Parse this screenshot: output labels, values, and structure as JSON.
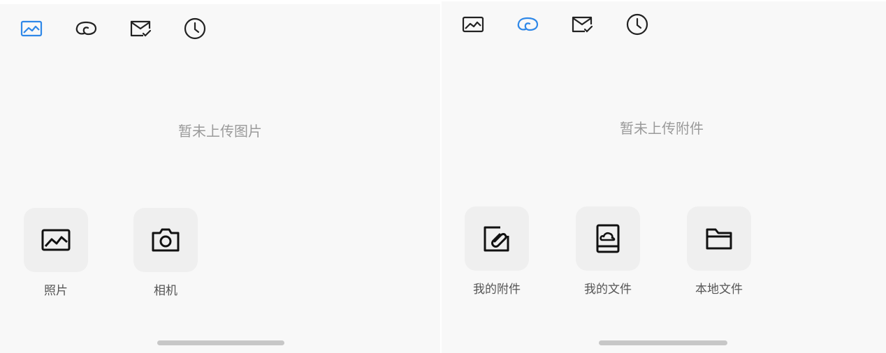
{
  "left_panel": {
    "tabs": [
      {
        "icon": "image-icon",
        "active": true
      },
      {
        "icon": "link-icon",
        "active": false
      },
      {
        "icon": "mail-check-icon",
        "active": false
      },
      {
        "icon": "clock-icon",
        "active": false
      }
    ],
    "empty_text": "暂未上传图片",
    "actions": [
      {
        "icon": "image-icon",
        "label": "照片"
      },
      {
        "icon": "camera-icon",
        "label": "相机"
      }
    ]
  },
  "right_panel": {
    "tabs": [
      {
        "icon": "image-icon",
        "active": false
      },
      {
        "icon": "link-icon",
        "active": true
      },
      {
        "icon": "mail-check-icon",
        "active": false
      },
      {
        "icon": "clock-icon",
        "active": false
      }
    ],
    "empty_text": "暂未上传附件",
    "actions": [
      {
        "icon": "attachment-icon",
        "label": "我的附件"
      },
      {
        "icon": "cloud-file-icon",
        "label": "我的文件"
      },
      {
        "icon": "folder-icon",
        "label": "本地文件"
      }
    ]
  },
  "colors": {
    "active_icon": "#2f88e8",
    "inactive_icon": "#222222",
    "background": "#f8f8f8",
    "tile": "#efefef"
  }
}
